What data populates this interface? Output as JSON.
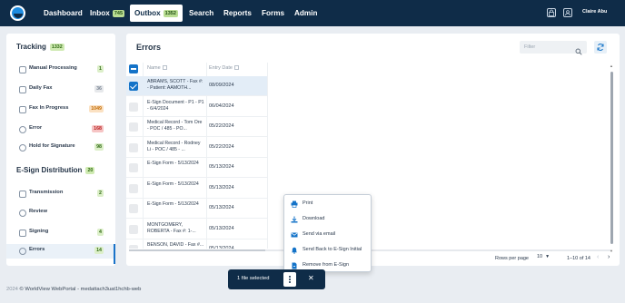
{
  "nav": {
    "items": [
      {
        "label": "Dashboard"
      },
      {
        "label": "Inbox",
        "badge": "745"
      },
      {
        "label": "Outbox",
        "badge": "1352"
      },
      {
        "label": "Search"
      },
      {
        "label": "Reports"
      },
      {
        "label": "Forms"
      },
      {
        "label": "Admin"
      }
    ],
    "active": "Outbox",
    "user_name": "Claire Abu"
  },
  "sidebar": {
    "tracking": {
      "title": "Tracking",
      "badge": "1332"
    },
    "tracking_items": [
      {
        "label": "Manual Processing",
        "count": "1",
        "icon": "document-icon"
      },
      {
        "label": "Daily Fax",
        "count": "36",
        "icon": "fax-icon"
      },
      {
        "label": "Fax In Progress",
        "count": "1049",
        "icon": "fax-progress-icon"
      },
      {
        "label": "Error",
        "count": "168",
        "icon": "warning-icon"
      },
      {
        "label": "Hold for Signature",
        "count": "98",
        "icon": "pen-icon"
      }
    ],
    "esign": {
      "title": "E-Sign Distribution",
      "badge": "20"
    },
    "esign_items": [
      {
        "label": "Transmission",
        "count": "2",
        "icon": "send-icon"
      },
      {
        "label": "Review",
        "count": "",
        "icon": "review-icon"
      },
      {
        "label": "Signing",
        "count": "4",
        "icon": "signing-icon"
      },
      {
        "label": "Errors",
        "count": "14",
        "icon": "error-icon"
      }
    ]
  },
  "main": {
    "title": "Errors",
    "filter_placeholder": "Filter",
    "columns": {
      "name": "Name",
      "date": "Entry Date"
    },
    "rows": [
      {
        "name": "ABRAMS, SCOTT - Fax #: - Patient: AAMOTH...",
        "date": "08/09/2024",
        "selected": true
      },
      {
        "name": "E-Sign Document - P1 - P1 - 6/4/2024",
        "date": "06/04/2024",
        "selected": false
      },
      {
        "name": "Medical Record - Tom Ore - POC / 485 - PO...",
        "date": "05/22/2024",
        "selected": false
      },
      {
        "name": "Medical Record - Rodney Li - POC / 485 - ...",
        "date": "05/22/2024",
        "selected": false
      },
      {
        "name": "E-Sign Form - 5/13/2024",
        "date": "05/13/2024",
        "selected": false
      },
      {
        "name": "E-Sign Form - 5/13/2024",
        "date": "05/13/2024",
        "selected": false
      },
      {
        "name": "E-Sign Form - 5/13/2024",
        "date": "05/13/2024",
        "selected": false
      },
      {
        "name": "MONTGOMERY, ROBERTA - Fax #: 1-...",
        "date": "05/13/2024",
        "selected": false
      },
      {
        "name": "BENSON, DAVID - Fax #...",
        "date": "05/13/2024",
        "selected": false
      }
    ],
    "pager": {
      "rows_per_page_label": "Rows per page",
      "rows_per_page_value": "10",
      "range": "1–10 of 14"
    }
  },
  "context_menu": {
    "items": [
      {
        "label": "Print",
        "icon": "print-icon"
      },
      {
        "label": "Download",
        "icon": "download-icon"
      },
      {
        "label": "Send via email",
        "icon": "email-icon"
      },
      {
        "label": "Send Back to E-Sign Initial",
        "icon": "bell-icon"
      },
      {
        "label": "Remove from E-Sign",
        "icon": "remove-document-icon"
      }
    ]
  },
  "selection_bar": {
    "text": "1 file selected"
  },
  "footer": {
    "year": "2024",
    "text": "© WorldView WebPortal - medattach3uat1hchb-web"
  },
  "colors": {
    "nav_bg": "#0f2c48",
    "accent": "#1473c8",
    "badge_green": "#cfeab2",
    "badge_red": "#f6c4c4",
    "badge_orange": "#fbe1c2"
  }
}
